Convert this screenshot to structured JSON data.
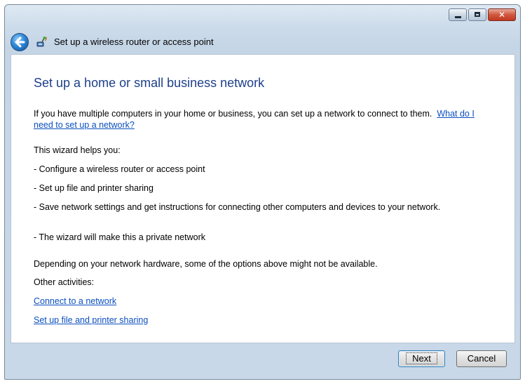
{
  "window": {
    "controls": {
      "minimize_icon": "minimize-icon",
      "maximize_icon": "maximize-icon",
      "close_glyph": "✕"
    }
  },
  "nav": {
    "back_icon": "back-arrow-icon",
    "wizard_icon": "network-icon",
    "title": "Set up a wireless router or access point"
  },
  "content": {
    "heading": "Set up a home or small business network",
    "intro": "If you have multiple computers in your home or business, you can set up a network to connect to them.",
    "intro_link": "What do I need to set up a network?",
    "helps_label": "This wizard helps you:",
    "bullets": [
      "- Configure a wireless router or access point",
      "- Set up file and printer sharing",
      "- Save network settings and get instructions for connecting other computers and devices to your network.",
      "- The wizard will make this a private network"
    ],
    "depending_note": "Depending on your network hardware, some of the options above might not be available.",
    "other_label": "Other activities:",
    "links": [
      "Connect to a network",
      "Set up file and printer sharing"
    ]
  },
  "footer": {
    "next_label": "Next",
    "cancel_label": "Cancel"
  }
}
